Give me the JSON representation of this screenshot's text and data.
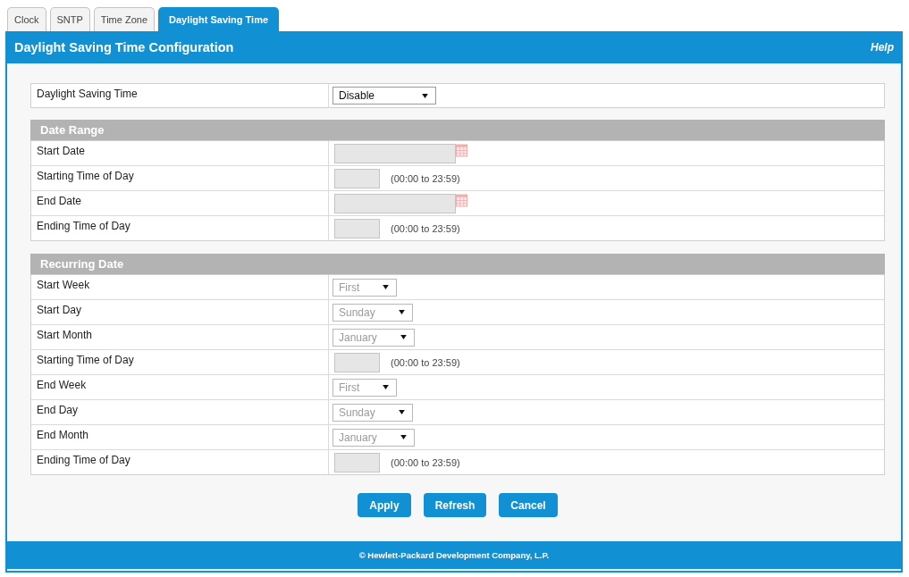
{
  "tabs": [
    {
      "label": "Clock",
      "selected": false
    },
    {
      "label": "SNTP",
      "selected": false
    },
    {
      "label": "Time Zone",
      "selected": false
    },
    {
      "label": "Daylight Saving Time",
      "selected": true
    }
  ],
  "header": {
    "title": "Daylight Saving Time Configuration",
    "help": "Help"
  },
  "mode": {
    "label": "Daylight Saving Time",
    "value": "Disable",
    "disabled": false
  },
  "sections": [
    {
      "title": "Date Range",
      "rows": [
        {
          "kind": "date",
          "label": "Start Date",
          "disabled": true
        },
        {
          "kind": "time",
          "label": "Starting Time of Day",
          "hint": "(00:00 to 23:59)",
          "disabled": true
        },
        {
          "kind": "date",
          "label": "End Date",
          "disabled": true
        },
        {
          "kind": "time",
          "label": "Ending Time of Day",
          "hint": "(00:00 to 23:59)",
          "disabled": true
        }
      ]
    },
    {
      "title": "Recurring Date",
      "rows": [
        {
          "kind": "select",
          "label": "Start Week",
          "value": "First",
          "disabled": true
        },
        {
          "kind": "select",
          "label": "Start Day",
          "value": "Sunday",
          "disabled": true
        },
        {
          "kind": "select",
          "label": "Start Month",
          "value": "January",
          "disabled": true
        },
        {
          "kind": "time",
          "label": "Starting Time of Day",
          "hint": "(00:00 to 23:59)",
          "disabled": true
        },
        {
          "kind": "select",
          "label": "End Week",
          "value": "First",
          "disabled": true
        },
        {
          "kind": "select",
          "label": "End Day",
          "value": "Sunday",
          "disabled": true
        },
        {
          "kind": "select",
          "label": "End Month",
          "value": "January",
          "disabled": true
        },
        {
          "kind": "time",
          "label": "Ending Time of Day",
          "hint": "(00:00 to 23:59)",
          "disabled": true
        }
      ]
    }
  ],
  "buttons": [
    "Apply",
    "Refresh",
    "Cancel"
  ],
  "footer": "© Hewlett-Packard Development Company, L.P."
}
